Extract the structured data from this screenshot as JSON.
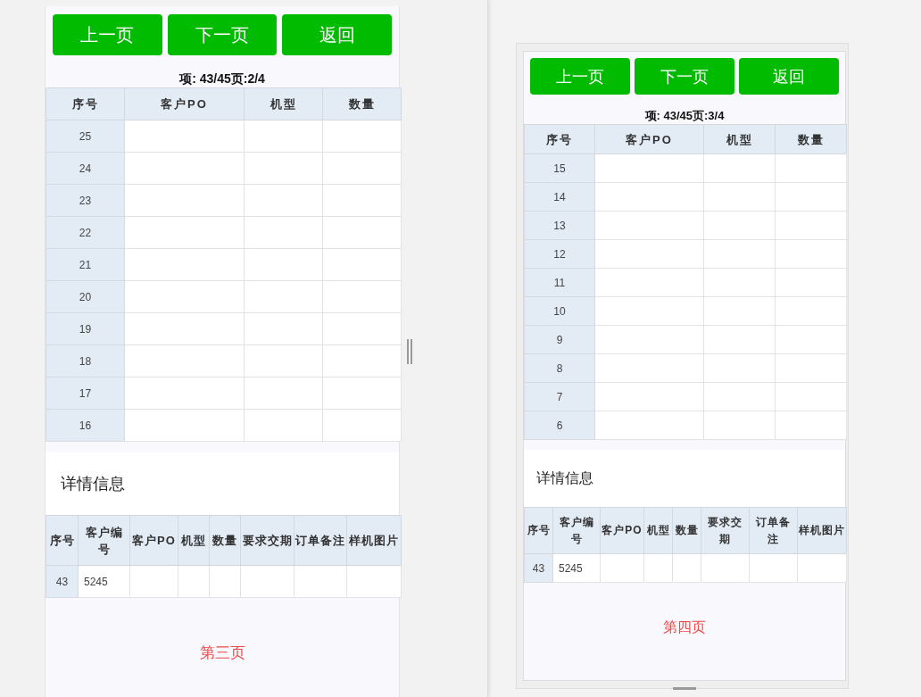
{
  "pages": [
    {
      "nav_buttons": [
        "上一页",
        "下一页",
        "返回"
      ],
      "info": "项: 43/45页:2/4",
      "columns": [
        "序号",
        "客户PO",
        "机型",
        "数量"
      ],
      "rows": [
        "25",
        "24",
        "23",
        "22",
        "21",
        "20",
        "19",
        "18",
        "17",
        "16"
      ],
      "detail_title": "详情信息",
      "detail_columns": [
        "序号",
        "客户编号",
        "客户PO",
        "机型",
        "数量",
        "要求交期",
        "订单备注",
        "样机图片"
      ],
      "detail_rows": [
        [
          "43",
          "5245",
          "",
          "",
          "",
          "",
          "",
          ""
        ]
      ],
      "page_label": "第三页"
    },
    {
      "nav_buttons": [
        "上一页",
        "下一页",
        "返回"
      ],
      "info": "项: 43/45页:3/4",
      "columns": [
        "序号",
        "客户PO",
        "机型",
        "数量"
      ],
      "rows": [
        "15",
        "14",
        "13",
        "12",
        "11",
        "10",
        "9",
        "8",
        "7",
        "6"
      ],
      "detail_title": "详情信息",
      "detail_columns": [
        "序号",
        "客户编号",
        "客户PO",
        "机型",
        "数量",
        "要求交期",
        "订单备注",
        "样机图片"
      ],
      "detail_rows": [
        [
          "43",
          "5245",
          "",
          "",
          "",
          "",
          "",
          ""
        ]
      ],
      "page_label": "第四页"
    }
  ]
}
